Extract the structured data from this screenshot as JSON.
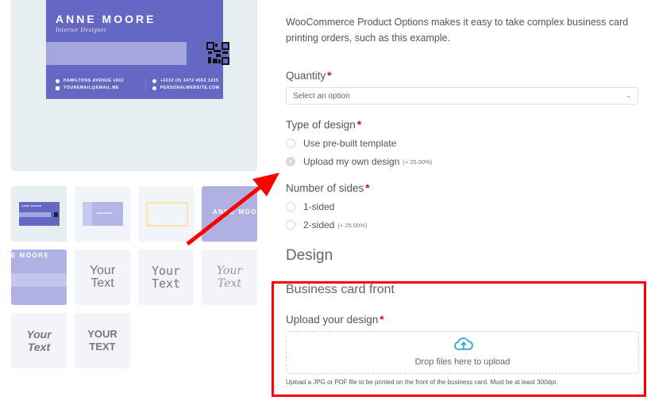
{
  "gallery": {
    "main_card": {
      "name": "ANNE MOORE",
      "title": "Interior Designer",
      "address": "HAMILTONS AVENUE 1602",
      "email": "YOUREMAIL@EMAIL.ME",
      "phone": "+2233 (0) 3472 4552 1225",
      "website": "PERSONALWEBSITE.COM",
      "accent_color": "#6568c2"
    },
    "thumbnails": [
      {
        "kind": "card-preview",
        "label": "ANNE MOORE"
      },
      {
        "kind": "card-back",
        "label": "ANNE MOORE"
      },
      {
        "kind": "bleed-guide",
        "label": ""
      },
      {
        "kind": "card-zoom",
        "label": "ANNE MOOR"
      },
      {
        "kind": "card-zoom-2",
        "label": "E MOORE"
      },
      {
        "kind": "font-sample",
        "label_1": "Your",
        "label_2": "Text"
      },
      {
        "kind": "font-sample",
        "label_1": "Your",
        "label_2": "Text"
      },
      {
        "kind": "font-sample",
        "label_1": "Your",
        "label_2": "Text"
      },
      {
        "kind": "font-sample",
        "label_1": "Your",
        "label_2": "Text"
      },
      {
        "kind": "font-sample",
        "label_1": "YOUR",
        "label_2": "TEXT"
      }
    ]
  },
  "form": {
    "intro": "WooCommerce Product Options makes it easy to take complex business card printing orders, such as this example.",
    "quantity": {
      "label": "Quantity",
      "required_mark": "*",
      "placeholder": "Select an option",
      "chevron": "⌄"
    },
    "type_of_design": {
      "label": "Type of design",
      "required_mark": "*",
      "options": [
        {
          "label": "Use pre-built template",
          "price": "",
          "checked": false
        },
        {
          "label": "Upload my own design",
          "price": "(+ 25.00%)",
          "checked": true
        }
      ]
    },
    "number_of_sides": {
      "label": "Number of sides",
      "required_mark": "*",
      "options": [
        {
          "label": "1-sided",
          "price": "",
          "checked": false
        },
        {
          "label": "2-sided",
          "price": "(+ 25.00%)",
          "checked": false
        }
      ]
    },
    "design_heading": "Design",
    "front": {
      "heading": "Business card front",
      "upload_label": "Upload your design",
      "required_mark": "*",
      "dropzone_text": "Drop files here to upload",
      "help_text": "Upload a JPG or PDF file to be printed on the front of the business card. Must be at least 300dpi."
    }
  },
  "annotations": {
    "highlight_color": "#ff0000"
  }
}
